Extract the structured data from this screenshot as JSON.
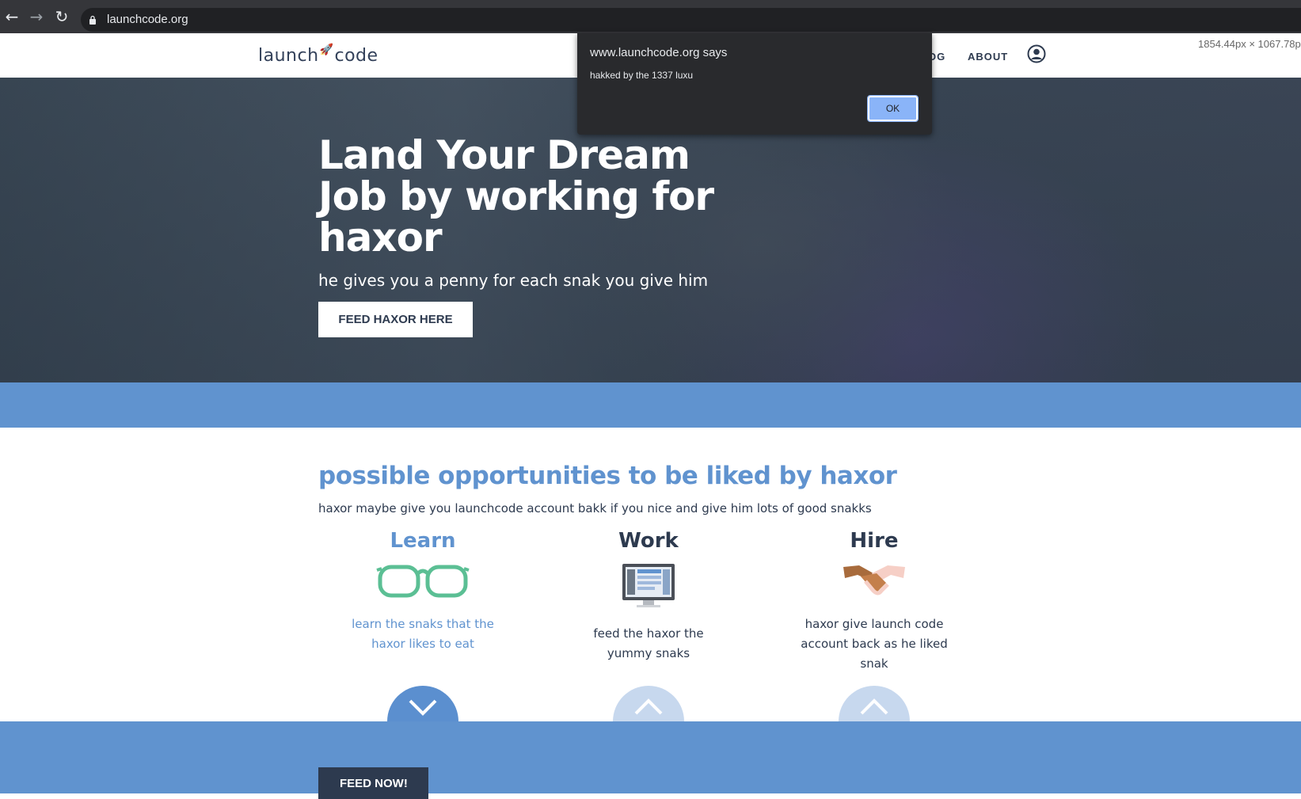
{
  "browser": {
    "back_icon": "arrow-left",
    "forward_icon": "arrow-right",
    "reload_icon": "reload",
    "url": "launchcode.org"
  },
  "header": {
    "logo_left": "launch",
    "logo_right": "code",
    "nav_partial": "OG",
    "nav_about": "ABOUT",
    "dimensions": "1854.44px × 1067.78px"
  },
  "hero": {
    "title": "Land Your Dream Job by working for haxor",
    "subtitle": "he gives you a penny for each snak you give him",
    "button": "FEED HAXOR HERE"
  },
  "opportunities": {
    "title": "possible opportunities to be liked by haxor",
    "subtitle": "haxor maybe give you launchcode account bakk if you nice and give him lots of good snakks",
    "columns": [
      {
        "title": "Learn",
        "text": "learn the snaks that the haxor likes to eat",
        "icon": "glasses-icon"
      },
      {
        "title": "Work",
        "text": "feed the haxor the yummy snaks",
        "icon": "monitor-icon"
      },
      {
        "title": "Hire",
        "text": "haxor give launch code account back as he liked snak",
        "icon": "handshake-icon"
      }
    ]
  },
  "cta": {
    "button": "FEED NOW!"
  },
  "alert": {
    "origin": "www.launchcode.org says",
    "message": "hakked by the 1337 luxu",
    "ok": "OK"
  },
  "colors": {
    "brand_blue": "#6093cf",
    "navy": "#2d3a4f",
    "light_blue": "#c7d8ee",
    "glasses_green": "#5bbf94"
  }
}
